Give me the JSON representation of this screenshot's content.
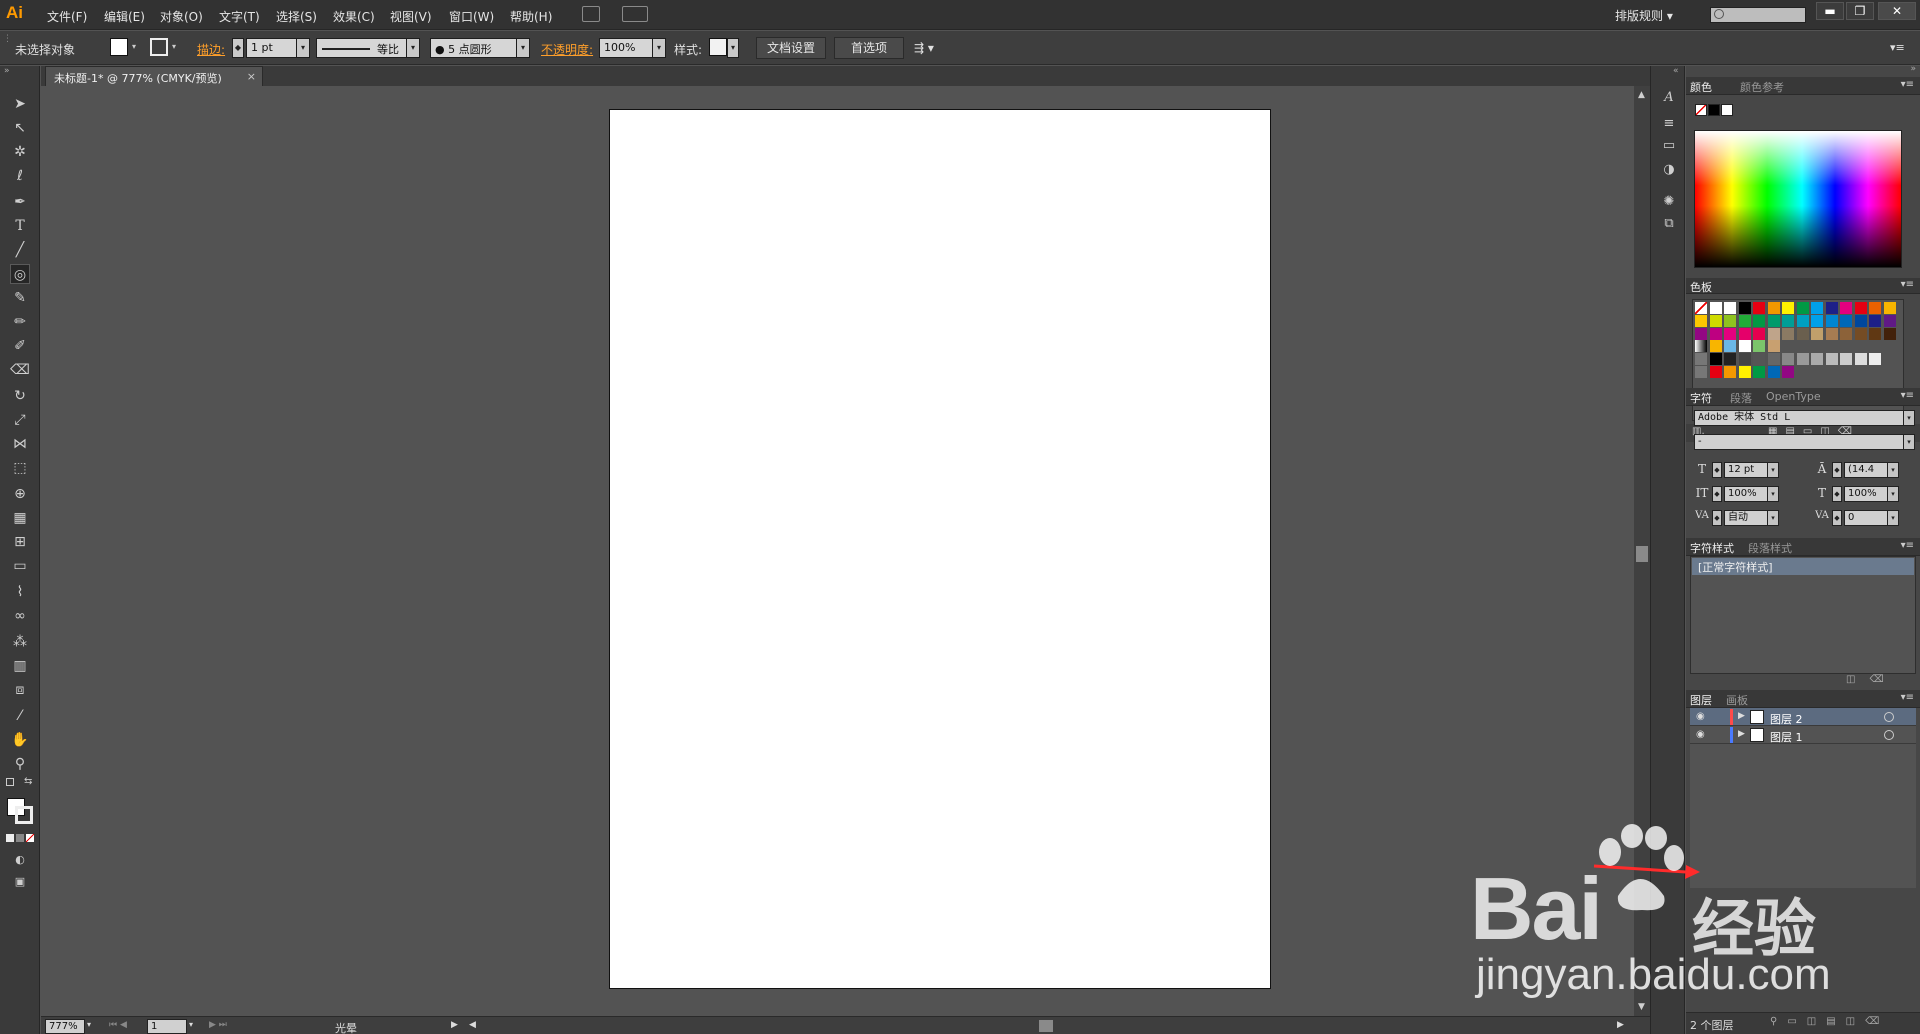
{
  "app": {
    "logo": "Ai"
  },
  "menu": {
    "items": [
      "文件(F)",
      "编辑(E)",
      "对象(O)",
      "文字(T)",
      "选择(S)",
      "效果(C)",
      "视图(V)",
      "窗口(W)",
      "帮助(H)"
    ],
    "workspace": "排版规则 ▾",
    "window_buttons": [
      "▬",
      "❐",
      "✕"
    ]
  },
  "control_bar": {
    "selection_status": "未选择对象",
    "stroke_label": "描边:",
    "stroke_weight": "1 pt",
    "stroke_profile": "等比",
    "brush": "● 5 点圆形",
    "opacity_label": "不透明度:",
    "opacity_value": "100%",
    "style_label": "样式:",
    "doc_setup_button": "文档设置",
    "preferences_button": "首选项"
  },
  "document": {
    "tab_title": "未标题-1* @ 777% (CMYK/预览)",
    "close_glyph": "×"
  },
  "status_bar": {
    "zoom": "777%",
    "artboard_number": "1",
    "tool_status": "光晕"
  },
  "panels": {
    "color": {
      "tabs": [
        "颜色",
        "颜色参考"
      ]
    },
    "swatches": {
      "tab": "色板"
    },
    "character": {
      "tabs": [
        "字符",
        "段落",
        "OpenType"
      ],
      "font_family": "Adobe 宋体 Std L",
      "font_style": "-",
      "font_size": "12 pt",
      "leading": "(14.4",
      "vertical_scale": "100%",
      "horizontal_scale": "100%",
      "kerning": "自动",
      "tracking": "0"
    },
    "char_styles": {
      "tabs": [
        "字符样式",
        "段落样式"
      ],
      "items": [
        "[正常字符样式]"
      ]
    },
    "layers": {
      "tabs": [
        "图层",
        "画板"
      ],
      "rows": [
        {
          "name": "图层 2",
          "selected": true
        },
        {
          "name": "图层 1",
          "selected": false
        }
      ],
      "count_label": "2 个图层"
    }
  },
  "watermark": {
    "brand": "Bai",
    "brand_cn": "经验",
    "url": "jingyan.baidu.com"
  },
  "colors": {
    "accent_orange": "#ff9f2a",
    "selection_blue": "#5c6b80",
    "artboard": "#ffffff",
    "pasteboard": "#535353"
  }
}
